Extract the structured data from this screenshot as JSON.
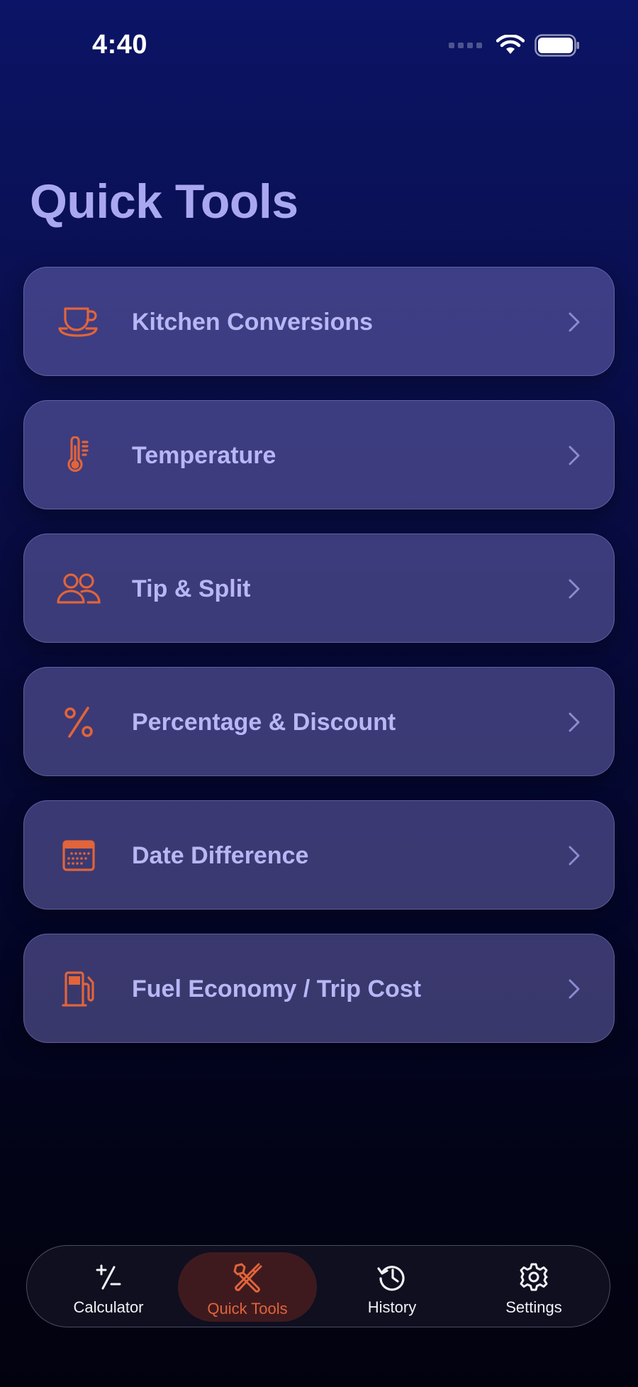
{
  "status_bar": {
    "time": "4:40"
  },
  "page": {
    "title": "Quick Tools"
  },
  "tools": [
    {
      "label": "Kitchen Conversions",
      "icon": "coffee-cup-icon"
    },
    {
      "label": "Temperature",
      "icon": "thermometer-icon"
    },
    {
      "label": "Tip & Split",
      "icon": "people-icon"
    },
    {
      "label": "Percentage & Discount",
      "icon": "percent-icon"
    },
    {
      "label": "Date Difference",
      "icon": "calendar-icon"
    },
    {
      "label": "Fuel Economy / Trip Cost",
      "icon": "fuel-pump-icon"
    }
  ],
  "tab_bar": {
    "items": [
      {
        "label": "Calculator",
        "icon": "plus-minus-icon",
        "active": false
      },
      {
        "label": "Quick Tools",
        "icon": "tools-icon",
        "active": true
      },
      {
        "label": "History",
        "icon": "history-icon",
        "active": false
      },
      {
        "label": "Settings",
        "icon": "gear-icon",
        "active": false
      }
    ]
  },
  "colors": {
    "accent": "#e1643a",
    "title": "#a9a7ef",
    "card_text": "#b8b6f5",
    "chevron": "#8d8ad0"
  }
}
